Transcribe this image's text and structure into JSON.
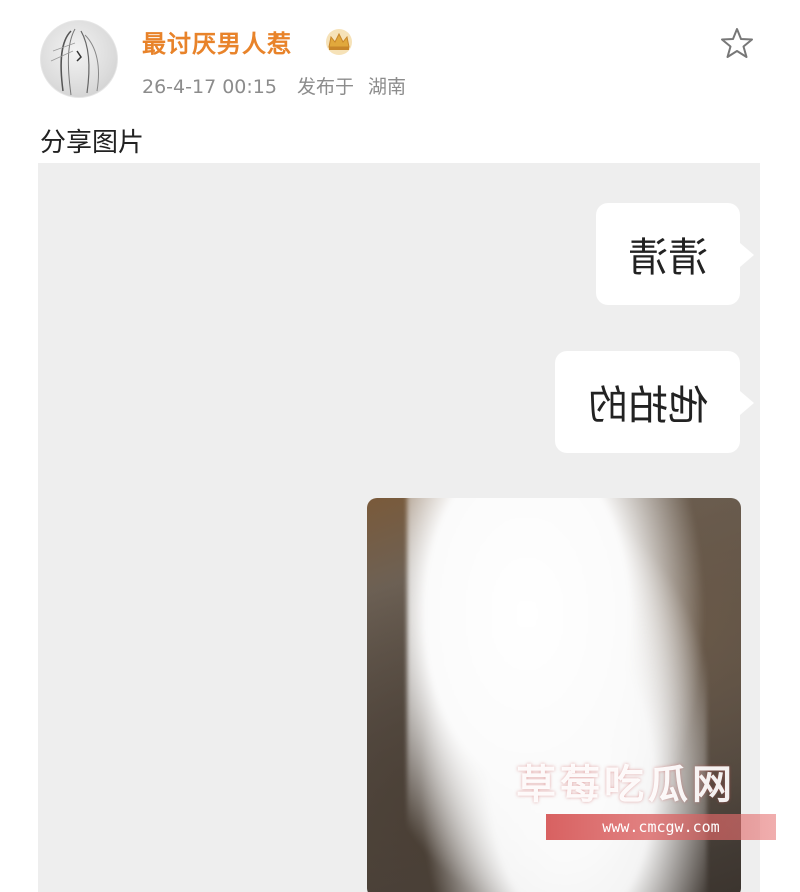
{
  "post": {
    "username": "最讨厌男人惹",
    "timestamp": "26-4-17 00:15",
    "location_prefix": "发布于",
    "location": "湖南",
    "text": "分享图片"
  },
  "image": {
    "bubbles": [
      "清清",
      "他拍的"
    ]
  },
  "watermark": {
    "title": "草莓吃瓜网",
    "url": "www.cmcgw.com"
  },
  "icons": {
    "crown": "crown-icon",
    "favorite": "star-icon"
  },
  "colors": {
    "username": "#e8832a",
    "meta": "#8c8c8c",
    "image_bg": "#eeeeee"
  }
}
